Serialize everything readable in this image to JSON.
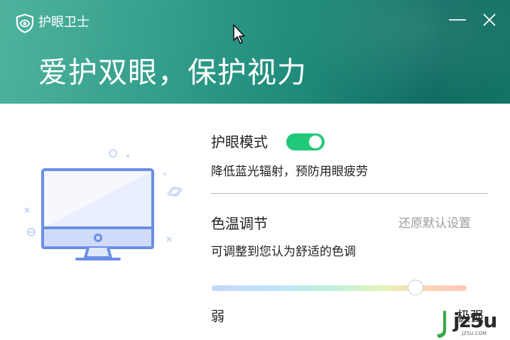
{
  "window": {
    "app_title": "护眼卫士",
    "headline": "爱护双眼，保护视力"
  },
  "eye_mode": {
    "label": "护眼模式",
    "enabled": true,
    "description": "降低蓝光辐射，预防用眼疲劳"
  },
  "color_temperature": {
    "label": "色温调节",
    "reset_label": "还原默认设置",
    "description": "可调整到您认为舒适的色调",
    "level": 0.8,
    "min_label": "弱",
    "max_label": "极强"
  },
  "watermark": {
    "text": "jz5u",
    "sub": "JZ5U.COM"
  },
  "colors": {
    "header_start": "#4fb39c",
    "header_end": "#0f6b62",
    "toggle_on": "#20c879",
    "illustration": "#6c8fe6"
  },
  "icons": {
    "app": "shield-eye-icon",
    "minimize": "minimize-icon",
    "close": "close-icon",
    "cursor": "mouse-cursor-icon",
    "illustration": "monitor-illustration"
  }
}
